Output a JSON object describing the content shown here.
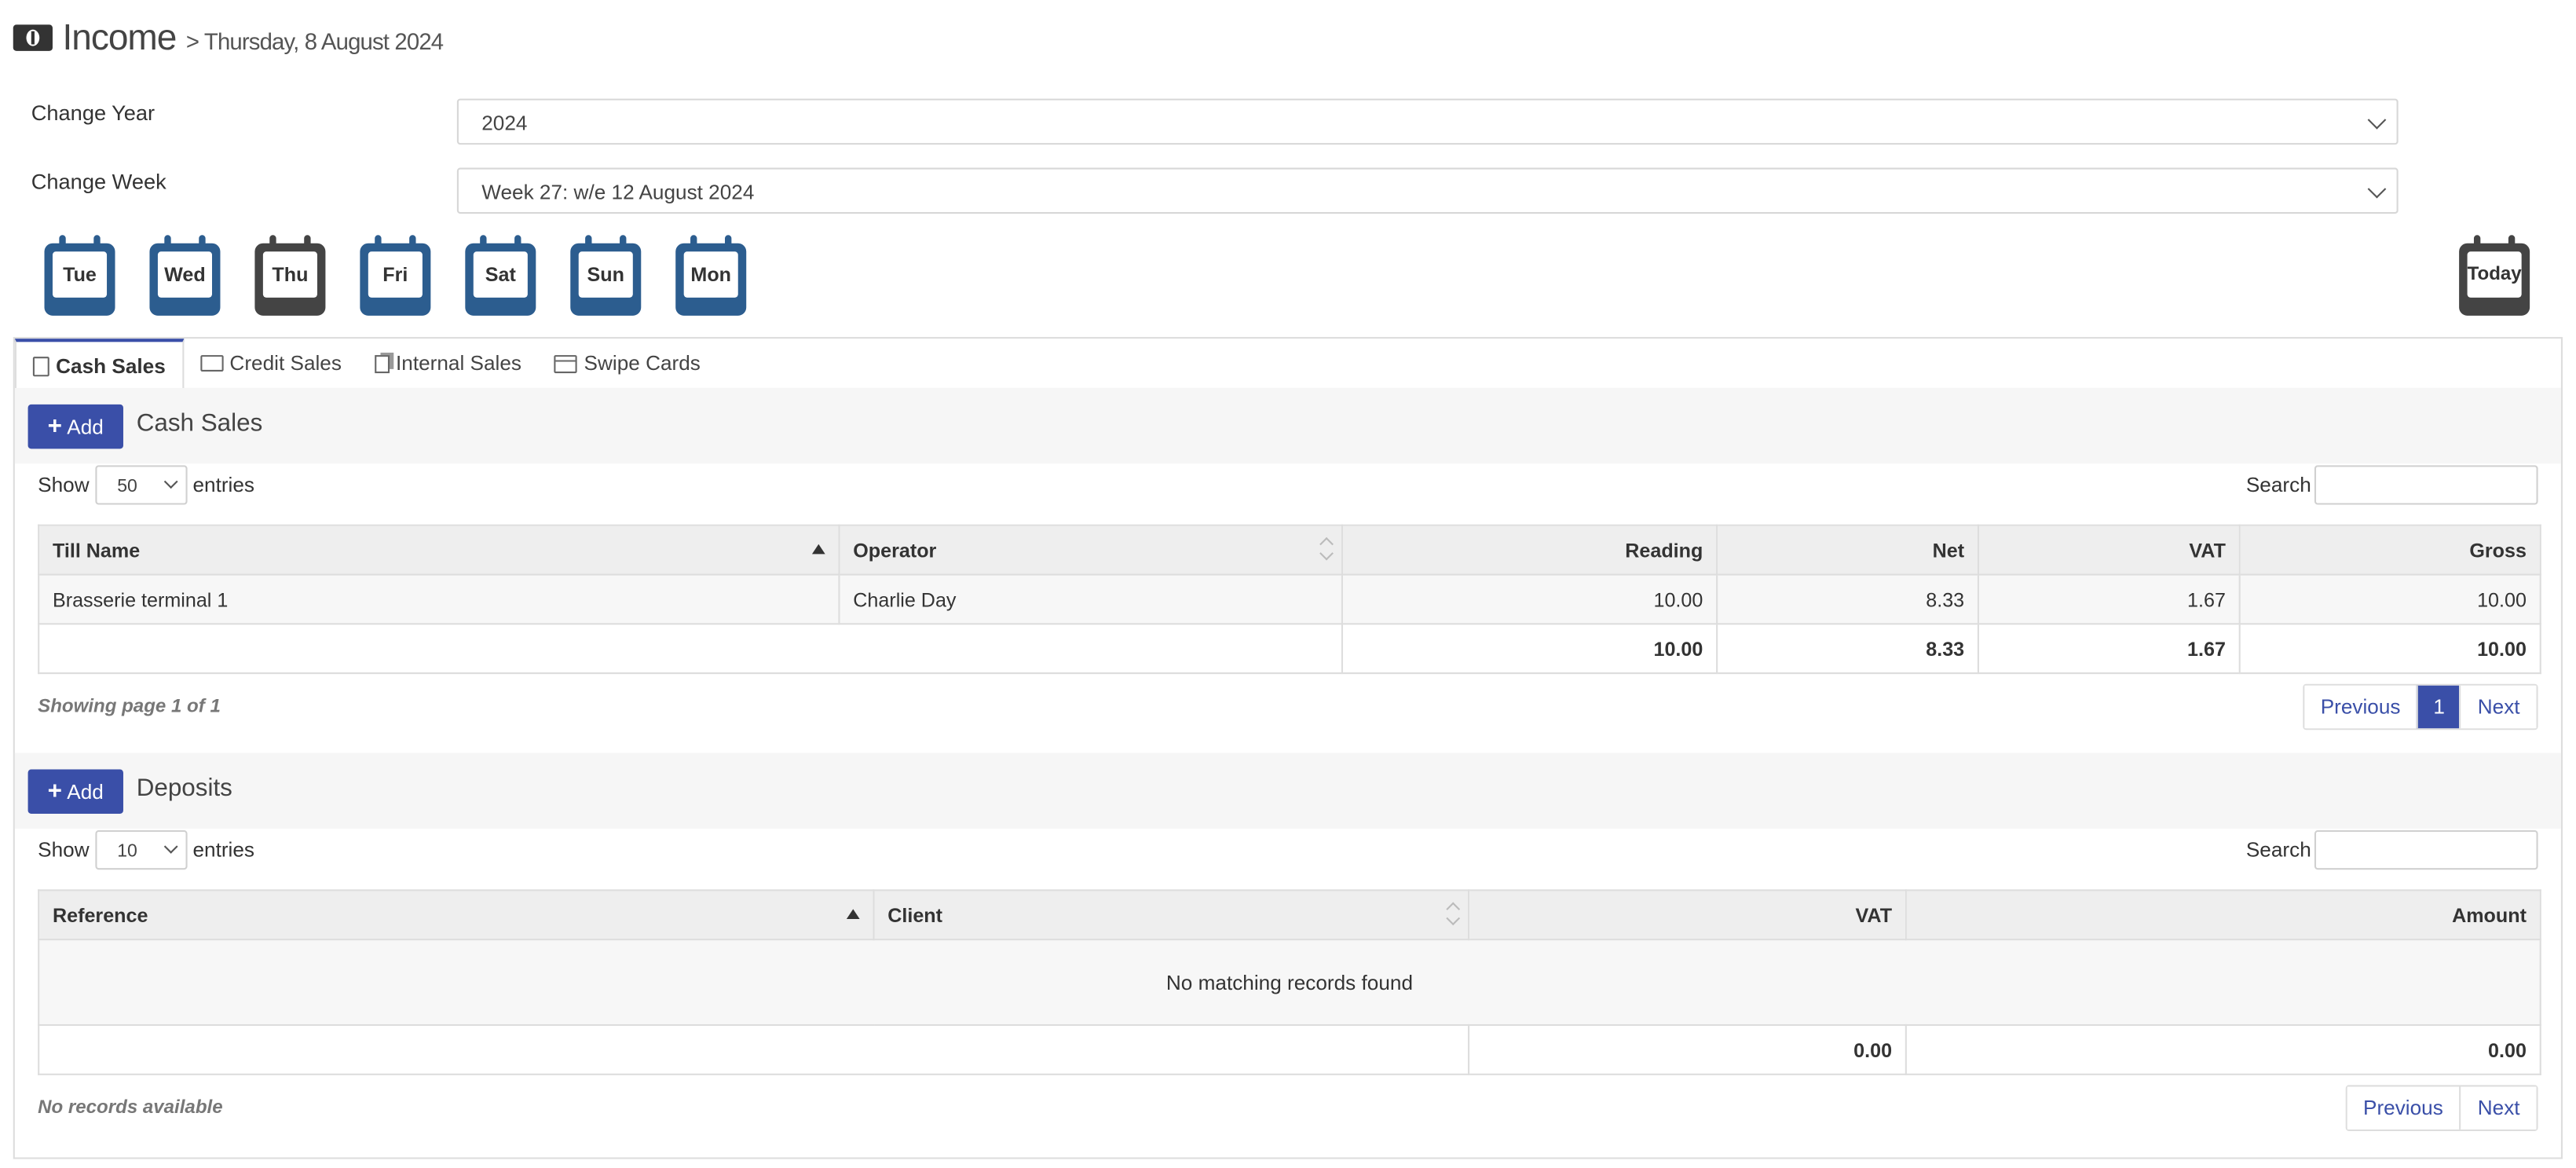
{
  "header": {
    "title": "Income",
    "subtitle": "> Thursday, 8 August 2024",
    "icon": "money-icon"
  },
  "filters": {
    "year_label": "Change Year",
    "year_value": "2024",
    "week_label": "Change Week",
    "week_value": "Week 27: w/e 12 August 2024"
  },
  "days": [
    {
      "label": "Tue"
    },
    {
      "label": "Wed"
    },
    {
      "label": "Thu"
    },
    {
      "label": "Fri"
    },
    {
      "label": "Sat"
    },
    {
      "label": "Sun"
    },
    {
      "label": "Mon"
    }
  ],
  "today_label": "Today",
  "tabs": [
    {
      "label": "Cash Sales",
      "icon": "document-icon"
    },
    {
      "label": "Credit Sales",
      "icon": "money-icon"
    },
    {
      "label": "Internal Sales",
      "icon": "copy-icon"
    },
    {
      "label": "Swipe Cards",
      "icon": "card-icon"
    }
  ],
  "cash_sales": {
    "add_label": "Add",
    "title": "Cash Sales",
    "show_label": "Show",
    "entries_label": "entries",
    "length_value": "50",
    "search_label": "Search",
    "columns": [
      "Till Name",
      "Operator",
      "Reading",
      "Net",
      "VAT",
      "Gross"
    ],
    "rows": [
      {
        "till": "Brasserie terminal 1",
        "operator": "Charlie Day",
        "reading": "10.00",
        "net": "8.33",
        "vat": "1.67",
        "gross": "10.00"
      }
    ],
    "totals": {
      "reading": "10.00",
      "net": "8.33",
      "vat": "1.67",
      "gross": "10.00"
    },
    "info": "Showing page 1 of 1",
    "pager": {
      "previous": "Previous",
      "page": "1",
      "next": "Next"
    }
  },
  "deposits": {
    "add_label": "Add",
    "title": "Deposits",
    "show_label": "Show",
    "entries_label": "entries",
    "length_value": "10",
    "search_label": "Search",
    "columns": [
      "Reference",
      "Client",
      "VAT",
      "Amount"
    ],
    "empty_text": "No matching records found",
    "totals": {
      "vat": "0.00",
      "amount": "0.00"
    },
    "info": "No records available",
    "pager": {
      "previous": "Previous",
      "next": "Next"
    }
  },
  "colors": {
    "accent": "#3a4fa8",
    "calendar_blue": "#2c5d8f",
    "calendar_dark": "#444444"
  }
}
